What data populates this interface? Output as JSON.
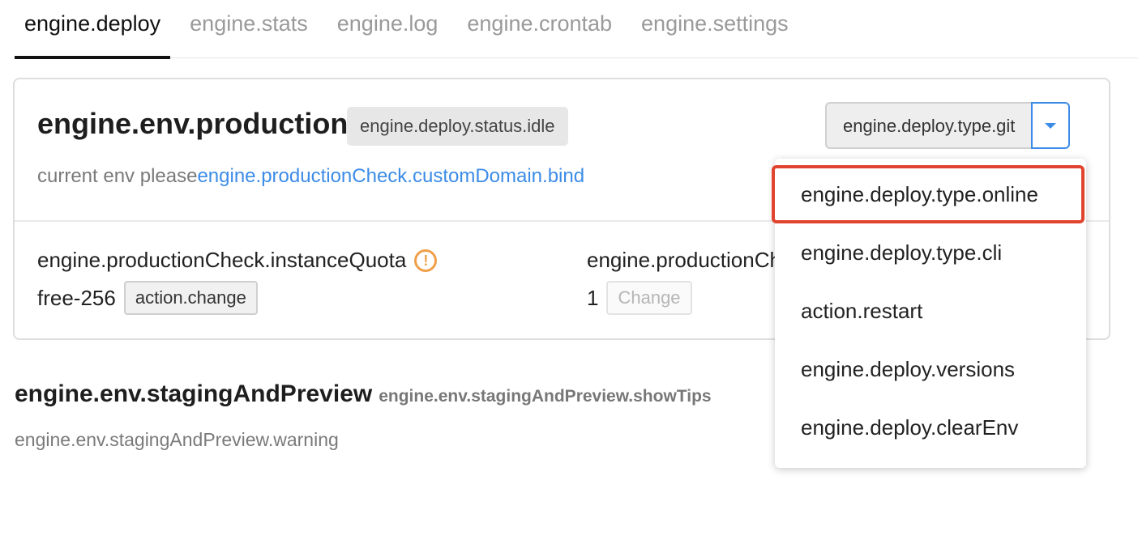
{
  "tabs": [
    {
      "label": "engine.deploy",
      "active": true
    },
    {
      "label": "engine.stats",
      "active": false
    },
    {
      "label": "engine.log",
      "active": false
    },
    {
      "label": "engine.crontab",
      "active": false
    },
    {
      "label": "engine.settings",
      "active": false
    }
  ],
  "production": {
    "title": "engine.env.production",
    "status": "engine.deploy.status.idle",
    "desc_prefix": "current env please",
    "desc_link": "engine.productionCheck.customDomain.bind",
    "deploy_button": "engine.deploy.type.git",
    "checks": [
      {
        "label": "engine.productionCheck.instanceQuota",
        "value": "free-256",
        "button": "action.change",
        "warning": true,
        "button_disabled": false
      },
      {
        "label": "engine.productionCheck.instances",
        "value": "1",
        "button": "Change",
        "warning": false,
        "button_disabled": true
      }
    ]
  },
  "staging": {
    "title": "engine.env.stagingAndPreview",
    "tips": "engine.env.stagingAndPreview.showTips",
    "warning": "engine.env.stagingAndPreview.warning"
  },
  "dropdown": {
    "items": [
      "engine.deploy.type.online",
      "engine.deploy.type.cli",
      "action.restart",
      "engine.deploy.versions",
      "engine.deploy.clearEnv"
    ],
    "highlighted_index": 0
  },
  "colors": {
    "accent": "#3c8ce7",
    "highlight_border": "#e0442e",
    "warning": "#f0a04b"
  },
  "icons": {
    "warning": "warning-circle-icon",
    "caret": "caret-down-icon"
  }
}
